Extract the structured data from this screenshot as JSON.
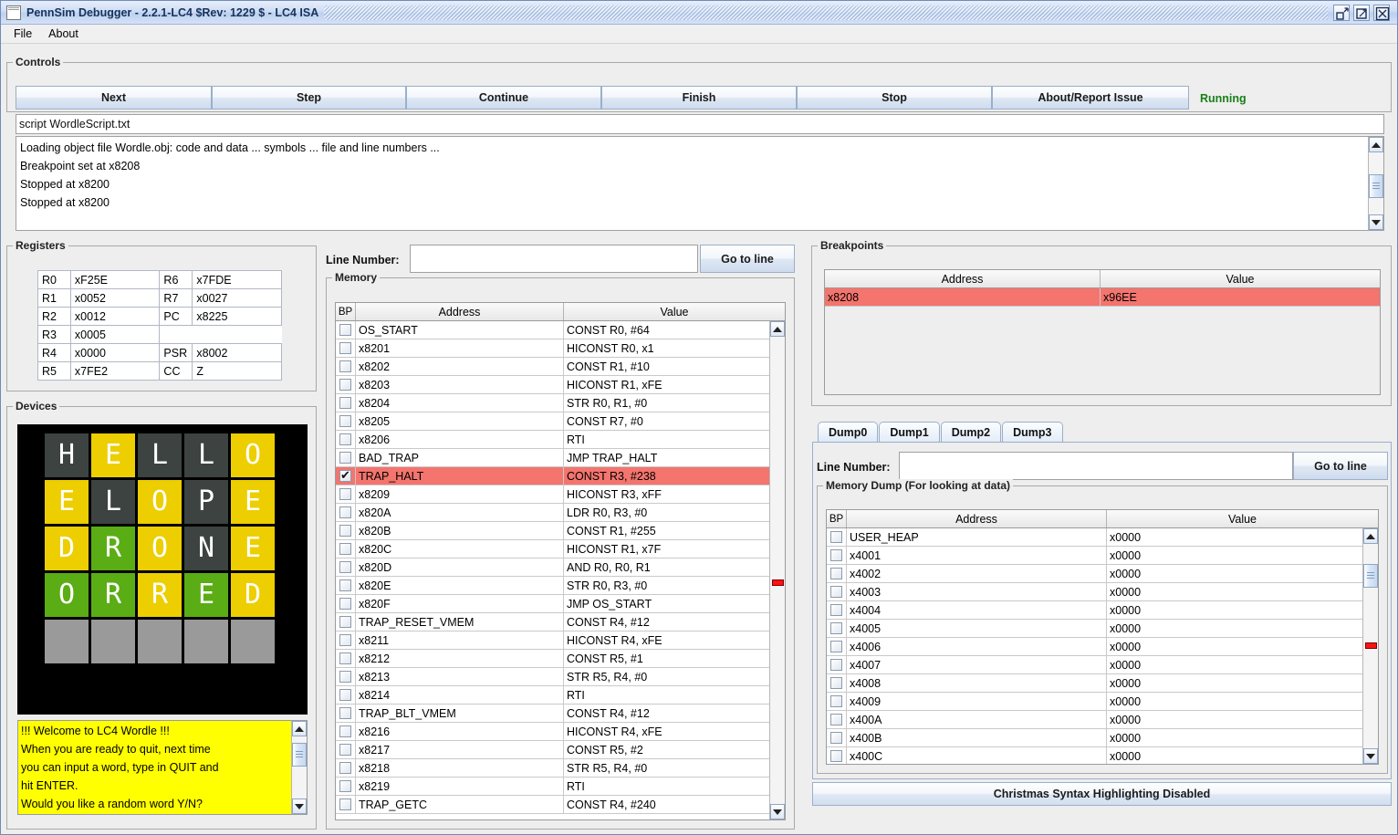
{
  "window": {
    "title": "PennSim Debugger - 2.2.1-LC4 $Rev: 1229 $ - LC4 ISA",
    "buttons": {
      "minimize": "minimize-icon",
      "maximize": "maximize-icon",
      "close": "close-icon"
    }
  },
  "menubar": {
    "items": [
      "File",
      "About"
    ]
  },
  "controls": {
    "legend": "Controls",
    "buttons": [
      "Next",
      "Step",
      "Continue",
      "Finish",
      "Stop",
      "About/Report Issue"
    ],
    "status": "Running",
    "status_color": "#187f18"
  },
  "command": {
    "value": "script WordleScript.txt",
    "placeholder": ""
  },
  "console": {
    "lines": [
      "Loading object file Wordle.obj: code and data ...  symbols ...  file and line numbers ...",
      "Breakpoint set at x8208",
      "Stopped at x8200",
      "Stopped at x8200"
    ]
  },
  "registers": {
    "legend": "Registers",
    "left": [
      {
        "name": "R0",
        "value": "xF25E"
      },
      {
        "name": "R1",
        "value": "x0052"
      },
      {
        "name": "R2",
        "value": "x0012"
      },
      {
        "name": "R3",
        "value": "x0005"
      },
      {
        "name": "R4",
        "value": "x0000"
      },
      {
        "name": "R5",
        "value": "x7FE2"
      }
    ],
    "right": [
      {
        "name": "R6",
        "value": "x7FDE"
      },
      {
        "name": "R7",
        "value": "x0027"
      },
      {
        "name": "PC",
        "value": "x8225"
      },
      {
        "name": "",
        "value": ""
      },
      {
        "name": "PSR",
        "value": "x8002"
      },
      {
        "name": "CC",
        "value": "Z"
      }
    ]
  },
  "devices": {
    "legend": "Devices",
    "colors": {
      "absent": "#3c4341",
      "present": "#edce00",
      "correct": "#5aad14",
      "empty": "#9a9a9a",
      "background": "#000000"
    },
    "grid": [
      [
        {
          "letter": "H",
          "state": "absent"
        },
        {
          "letter": "E",
          "state": "present"
        },
        {
          "letter": "L",
          "state": "absent"
        },
        {
          "letter": "L",
          "state": "absent"
        },
        {
          "letter": "O",
          "state": "present"
        }
      ],
      [
        {
          "letter": "E",
          "state": "present"
        },
        {
          "letter": "L",
          "state": "absent"
        },
        {
          "letter": "O",
          "state": "present"
        },
        {
          "letter": "P",
          "state": "absent"
        },
        {
          "letter": "E",
          "state": "present"
        }
      ],
      [
        {
          "letter": "D",
          "state": "present"
        },
        {
          "letter": "R",
          "state": "correct"
        },
        {
          "letter": "O",
          "state": "present"
        },
        {
          "letter": "N",
          "state": "absent"
        },
        {
          "letter": "E",
          "state": "present"
        }
      ],
      [
        {
          "letter": "O",
          "state": "correct"
        },
        {
          "letter": "R",
          "state": "correct"
        },
        {
          "letter": "R",
          "state": "present"
        },
        {
          "letter": "E",
          "state": "correct"
        },
        {
          "letter": "D",
          "state": "present"
        }
      ],
      [
        {
          "letter": "",
          "state": "empty"
        },
        {
          "letter": "",
          "state": "empty"
        },
        {
          "letter": "",
          "state": "empty"
        },
        {
          "letter": "",
          "state": "empty"
        },
        {
          "letter": "",
          "state": "empty"
        }
      ]
    ]
  },
  "device_console": {
    "lines": [
      "!!! Welcome to LC4 Wordle !!!",
      "When you are ready to quit, next time",
      "you can input a word, type in QUIT and",
      "hit ENTER.",
      "Would you like a random word Y/N?"
    ]
  },
  "memory_panel": {
    "line_number_label": "Line Number:",
    "line_number_value": "",
    "goto_label": "Go to line",
    "legend": "Memory",
    "columns": [
      "BP",
      "Address",
      "Value"
    ],
    "rows": [
      {
        "bp": false,
        "address": "OS_START",
        "value": "CONST R0, #64",
        "highlight": false
      },
      {
        "bp": false,
        "address": "x8201",
        "value": "HICONST R0, x1",
        "highlight": false
      },
      {
        "bp": false,
        "address": "x8202",
        "value": "CONST R1, #10",
        "highlight": false
      },
      {
        "bp": false,
        "address": "x8203",
        "value": "HICONST R1, xFE",
        "highlight": false
      },
      {
        "bp": false,
        "address": "x8204",
        "value": "STR R0, R1, #0",
        "highlight": false
      },
      {
        "bp": false,
        "address": "x8205",
        "value": "CONST R7, #0",
        "highlight": false
      },
      {
        "bp": false,
        "address": "x8206",
        "value": "RTI",
        "highlight": false
      },
      {
        "bp": false,
        "address": "BAD_TRAP",
        "value": "JMP TRAP_HALT",
        "highlight": false
      },
      {
        "bp": true,
        "address": "TRAP_HALT",
        "value": "CONST R3, #238",
        "highlight": true
      },
      {
        "bp": false,
        "address": "x8209",
        "value": "HICONST R3, xFF",
        "highlight": false
      },
      {
        "bp": false,
        "address": "x820A",
        "value": "LDR R0, R3, #0",
        "highlight": false
      },
      {
        "bp": false,
        "address": "x820B",
        "value": "CONST R1, #255",
        "highlight": false
      },
      {
        "bp": false,
        "address": "x820C",
        "value": "HICONST R1, x7F",
        "highlight": false
      },
      {
        "bp": false,
        "address": "x820D",
        "value": "AND R0, R0, R1",
        "highlight": false
      },
      {
        "bp": false,
        "address": "x820E",
        "value": "STR R0, R3, #0",
        "highlight": false
      },
      {
        "bp": false,
        "address": "x820F",
        "value": "JMP OS_START",
        "highlight": false
      },
      {
        "bp": false,
        "address": "TRAP_RESET_VMEM",
        "value": "CONST R4, #12",
        "highlight": false
      },
      {
        "bp": false,
        "address": "x8211",
        "value": "HICONST R4, xFE",
        "highlight": false
      },
      {
        "bp": false,
        "address": "x8212",
        "value": "CONST R5, #1",
        "highlight": false
      },
      {
        "bp": false,
        "address": "x8213",
        "value": "STR R5, R4, #0",
        "highlight": false
      },
      {
        "bp": false,
        "address": "x8214",
        "value": "RTI",
        "highlight": false
      },
      {
        "bp": false,
        "address": "TRAP_BLT_VMEM",
        "value": "CONST R4, #12",
        "highlight": false
      },
      {
        "bp": false,
        "address": "x8216",
        "value": "HICONST R4, xFE",
        "highlight": false
      },
      {
        "bp": false,
        "address": "x8217",
        "value": "CONST R5, #2",
        "highlight": false
      },
      {
        "bp": false,
        "address": "x8218",
        "value": "STR R5, R4, #0",
        "highlight": false
      },
      {
        "bp": false,
        "address": "x8219",
        "value": "RTI",
        "highlight": false
      },
      {
        "bp": false,
        "address": "TRAP_GETC",
        "value": "CONST R4, #240",
        "highlight": false
      }
    ]
  },
  "breakpoints": {
    "legend": "Breakpoints",
    "columns": [
      "Address",
      "Value"
    ],
    "rows": [
      {
        "address": "x8208",
        "value": "x96EE",
        "highlight": true
      }
    ]
  },
  "dump": {
    "tabs": [
      "Dump0",
      "Dump1",
      "Dump2",
      "Dump3"
    ],
    "active_tab": "Dump0",
    "line_number_label": "Line Number:",
    "line_number_value": "",
    "goto_label": "Go to line",
    "legend": "Memory Dump (For looking at data)",
    "columns": [
      "BP",
      "Address",
      "Value"
    ],
    "rows": [
      {
        "bp": false,
        "address": "USER_HEAP",
        "value": "x0000"
      },
      {
        "bp": false,
        "address": "x4001",
        "value": "x0000"
      },
      {
        "bp": false,
        "address": "x4002",
        "value": "x0000"
      },
      {
        "bp": false,
        "address": "x4003",
        "value": "x0000"
      },
      {
        "bp": false,
        "address": "x4004",
        "value": "x0000"
      },
      {
        "bp": false,
        "address": "x4005",
        "value": "x0000"
      },
      {
        "bp": false,
        "address": "x4006",
        "value": "x0000"
      },
      {
        "bp": false,
        "address": "x4007",
        "value": "x0000"
      },
      {
        "bp": false,
        "address": "x4008",
        "value": "x0000"
      },
      {
        "bp": false,
        "address": "x4009",
        "value": "x0000"
      },
      {
        "bp": false,
        "address": "x400A",
        "value": "x0000"
      },
      {
        "bp": false,
        "address": "x400B",
        "value": "x0000"
      },
      {
        "bp": false,
        "address": "x400C",
        "value": "x0000"
      }
    ]
  },
  "statusbar": {
    "text": "Christmas Syntax Highlighting Disabled"
  }
}
